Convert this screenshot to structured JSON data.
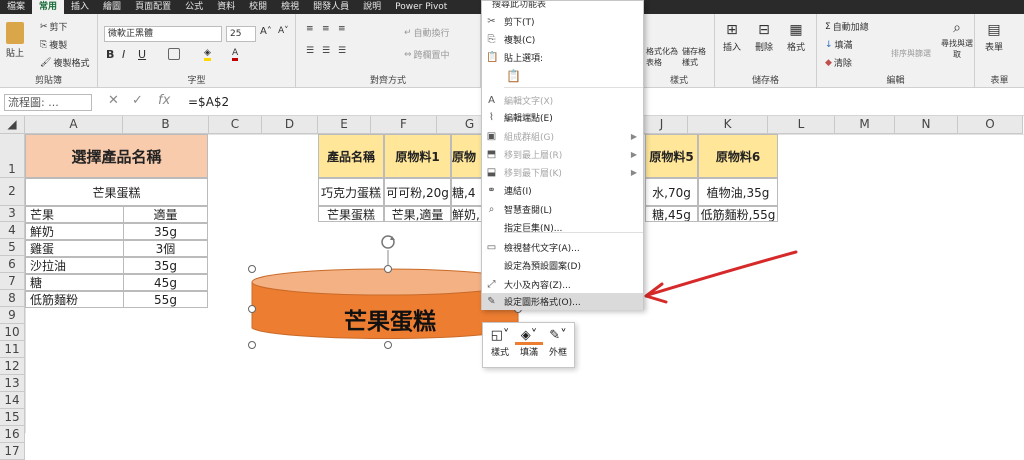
{
  "tabs": [
    "檔案",
    "常用",
    "插入",
    "繪圖",
    "頁面配置",
    "公式",
    "資料",
    "校閱",
    "檢視",
    "開發人員",
    "說明",
    "Power Pivot"
  ],
  "active_tab": "常用",
  "ribbon": {
    "clipboard": {
      "paste": "貼上",
      "cut": "剪下",
      "copy": "複製",
      "format_painter": "複製格式",
      "label": "剪貼簿"
    },
    "font": {
      "font_name": "微軟正黑體",
      "font_size": "25",
      "bold": "B",
      "italic": "I",
      "underline": "U",
      "label": "字型"
    },
    "alignment": {
      "wrap": "自動換行",
      "merge": "跨欄置中",
      "label": "對齊方式"
    },
    "styles": {
      "fmt_table": "格式化為表格",
      "cell_styles": "儲存格樣式",
      "label": "樣式"
    },
    "cells": {
      "insert": "插入",
      "delete": "刪除",
      "format": "格式",
      "label": "儲存格"
    },
    "editing": {
      "autosum": "自動加總",
      "fill": "填滿",
      "clear": "清除",
      "sort": "排序與篩選",
      "find": "尋找與選取",
      "label": "編輯"
    },
    "form": {
      "form": "表單",
      "label": "表單"
    }
  },
  "formula_bar": {
    "name_box": "流程圖: ...",
    "fx": "fx",
    "cancel": "✕",
    "enter": "✓",
    "formula": "=$A$2"
  },
  "columns": [
    "A",
    "B",
    "C",
    "D",
    "E",
    "F",
    "G",
    "H",
    "I",
    "J",
    "K",
    "L",
    "M",
    "N",
    "O"
  ],
  "rows": [
    "1",
    "2",
    "3",
    "4",
    "5",
    "6",
    "7",
    "8",
    "9",
    "10",
    "11",
    "12",
    "13",
    "14",
    "15",
    "16",
    "17"
  ],
  "sheet": {
    "a1": "選擇產品名稱",
    "a2": "芒果蛋糕",
    "left_table": [
      [
        "芒果",
        "適量"
      ],
      [
        "鮮奶",
        "35g"
      ],
      [
        "雞蛋",
        "3個"
      ],
      [
        "沙拉油",
        "35g"
      ],
      [
        "糖",
        "45g"
      ],
      [
        "低筋麵粉",
        "55g"
      ]
    ],
    "headers": [
      "產品名稱",
      "原物料1",
      "原物",
      "原物料5",
      "原物料6"
    ],
    "row2": [
      "巧克力蛋糕",
      "可可粉,20g",
      "糖,4",
      "水,70g",
      "植物油,35g"
    ],
    "row3": [
      "芒果蛋糕",
      "芒果,適量",
      "鮮奶,",
      "糖,45g",
      "低筋麵粉,55g"
    ]
  },
  "shape_text": "芒果蛋糕",
  "context_menu": {
    "search": "搜尋此功能表",
    "items": [
      {
        "label": "剪下(T)",
        "icon": "cut-icon",
        "disabled": false
      },
      {
        "label": "複製(C)",
        "icon": "copy-icon",
        "disabled": false
      },
      {
        "label": "貼上選項:",
        "icon": "paste-icon",
        "disabled": false
      },
      {
        "label": "編輯文字(X)",
        "icon": "edit-text-icon",
        "disabled": true
      },
      {
        "label": "編輯端點(E)",
        "icon": "edit-points-icon",
        "disabled": false
      },
      {
        "label": "組成群組(G)",
        "icon": "group-icon",
        "disabled": true
      },
      {
        "label": "移到最上層(R)",
        "icon": "bring-front-icon",
        "disabled": true
      },
      {
        "label": "移到最下層(K)",
        "icon": "send-back-icon",
        "disabled": true
      },
      {
        "label": "連結(I)",
        "icon": "link-icon",
        "disabled": false
      },
      {
        "label": "智慧查閱(L)",
        "icon": "smart-lookup-icon",
        "disabled": false
      },
      {
        "label": "指定巨集(N)...",
        "icon": "",
        "disabled": false
      },
      {
        "label": "檢視替代文字(A)...",
        "icon": "alt-text-icon",
        "disabled": false
      },
      {
        "label": "設定為預設圖案(D)",
        "icon": "",
        "disabled": false
      },
      {
        "label": "大小及內容(Z)...",
        "icon": "size-icon",
        "disabled": false
      },
      {
        "label": "設定圖形格式(O)...",
        "icon": "format-shape-icon",
        "disabled": false
      }
    ]
  },
  "mini_toolbar": {
    "style": "樣式",
    "fill": "填滿",
    "outline": "外框"
  },
  "colors": {
    "ribbon_active": "#1e6e3c",
    "orange_header": "#f8cbad",
    "yellow_header": "#ffe699",
    "shape_fill": "#ed7d31",
    "arrow": "#d62a2a"
  }
}
